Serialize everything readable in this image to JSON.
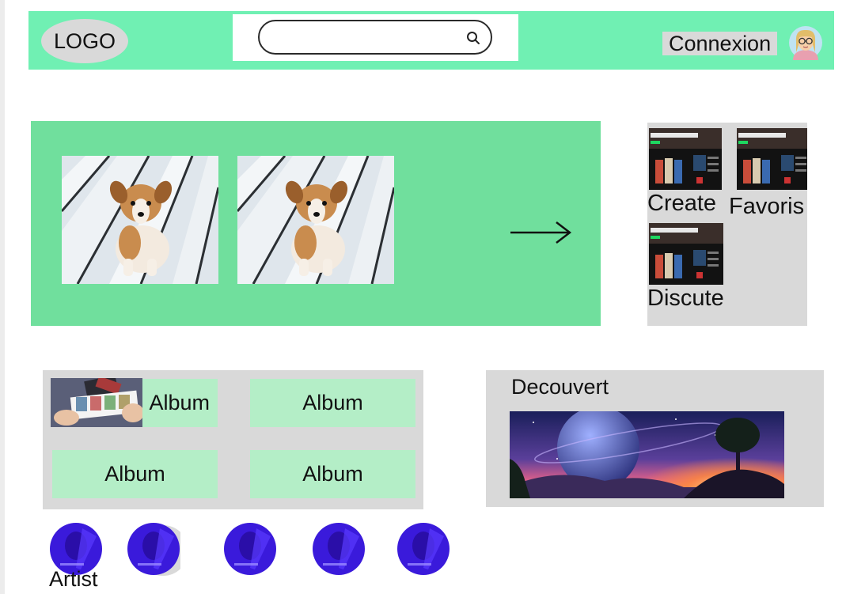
{
  "header": {
    "logo": "LOGO",
    "search": {
      "value": "",
      "placeholder": ""
    },
    "login_label": "Connexion"
  },
  "hero": {
    "images": [
      "puppy",
      "puppy"
    ],
    "next_icon": "arrow-right-icon"
  },
  "side_menu": {
    "items": [
      {
        "label": "Create"
      },
      {
        "label": "Favoris"
      },
      {
        "label": "Discute"
      }
    ]
  },
  "albums": {
    "items": [
      {
        "label": "Album"
      },
      {
        "label": "Album"
      },
      {
        "label": "Album"
      },
      {
        "label": "Album"
      }
    ]
  },
  "discover": {
    "title": "Decouvert"
  },
  "artists": {
    "label": "Artist"
  },
  "colors": {
    "header_bg": "#70f0b3",
    "hero_bg": "#70df9d",
    "panel_bg": "#d9d9d9",
    "album_tile_bg": "#b4eec7"
  }
}
